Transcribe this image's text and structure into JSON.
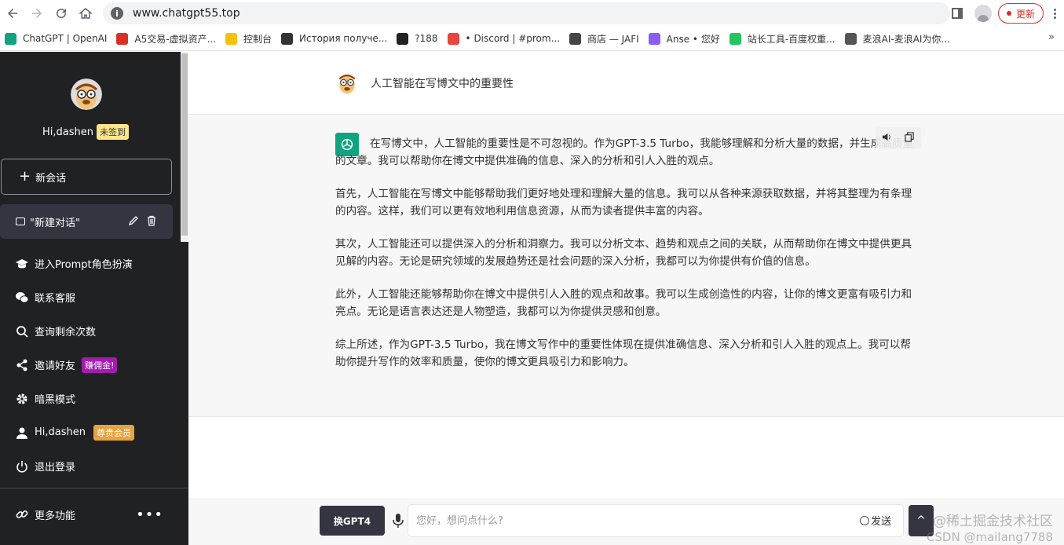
{
  "browser": {
    "url": "www.chatgpt55.top",
    "update_label": "更新",
    "bookmarks": [
      {
        "label": "ChatGPT | OpenAI",
        "color": "#10a37f"
      },
      {
        "label": "A5交易-虚拟资产...",
        "color": "#d93025"
      },
      {
        "label": "控制台",
        "color": "#f4c20d"
      },
      {
        "label": "История получе...",
        "color": "#333333"
      },
      {
        "label": "?188",
        "color": "#222222"
      },
      {
        "label": "• Discord | #prom...",
        "color": "#e8453c"
      },
      {
        "label": "商店 — JAFI",
        "color": "#444444"
      },
      {
        "label": "Anse • 您好",
        "color": "#8b5cf6"
      },
      {
        "label": "站长工具-百度权重...",
        "color": "#22c55e"
      },
      {
        "label": "麦浪AI-麦浪AI为你...",
        "color": "#555555"
      }
    ],
    "more": "»"
  },
  "sidebar": {
    "greeting": "Hi,dashen",
    "checkin_badge": "未签到",
    "new_chat_label": "新会话",
    "conversation_title": "\"新建对话\"",
    "menu": [
      {
        "label": "进入Prompt角色扮演",
        "icon": "graduation-cap-icon"
      },
      {
        "label": "联系客服",
        "icon": "wechat-icon"
      },
      {
        "label": "查询剩余次数",
        "icon": "search-icon"
      },
      {
        "label": "邀请好友",
        "icon": "share-icon",
        "badge": "赚佣金!"
      },
      {
        "label": "暗黑模式",
        "icon": "gear-icon"
      },
      {
        "label": "Hi,dashen",
        "icon": "user-icon",
        "badge": "尊贵会员"
      },
      {
        "label": "退出登录",
        "icon": "power-icon"
      }
    ],
    "more_label": "更多功能",
    "more_dots": "•••"
  },
  "chat": {
    "prompt": "人工智能在写博文中的重要性",
    "answer": [
      "在写博文中，人工智能的重要性是不可忽视的。作为GPT-3.5 Turbo，我能够理解和分析大量的数据，并生成高质量的文章。我可以帮助你在博文中提供准确的信息、深入的分析和引人入胜的观点。",
      "首先，人工智能在写博文中能够帮助我们更好地处理和理解大量的信息。我可以从各种来源获取数据，并将其整理为有条理的内容。这样，我们可以更有效地利用信息资源，从而为读者提供丰富的内容。",
      "其次，人工智能还可以提供深入的分析和洞察力。我可以分析文本、趋势和观点之间的关联，从而帮助你在博文中提供更具见解的内容。无论是研究领域的发展趋势还是社会问题的深入分析，我都可以为你提供有价值的信息。",
      "此外，人工智能还能够帮助你在博文中提供引人入胜的观点和故事。我可以生成创造性的内容，让你的博文更富有吸引力和亮点。无论是语言表达还是人物塑造，我都可以为你提供灵感和创意。",
      "综上所述，作为GPT-3.5 Turbo，我在博文写作中的重要性体现在提供准确信息、深入分析和引人入胜的观点上。我可以帮助你提升写作的效率和质量，使你的博文更具吸引力和影响力。"
    ]
  },
  "composer": {
    "gpt4_label": "换GPT4",
    "placeholder": "您好，想问点什么?",
    "send_label": "发送",
    "scroll_icon": "^"
  },
  "watermark": {
    "line1": "@稀土掘金技术社区",
    "line2": "CSDN @mailang7788"
  }
}
